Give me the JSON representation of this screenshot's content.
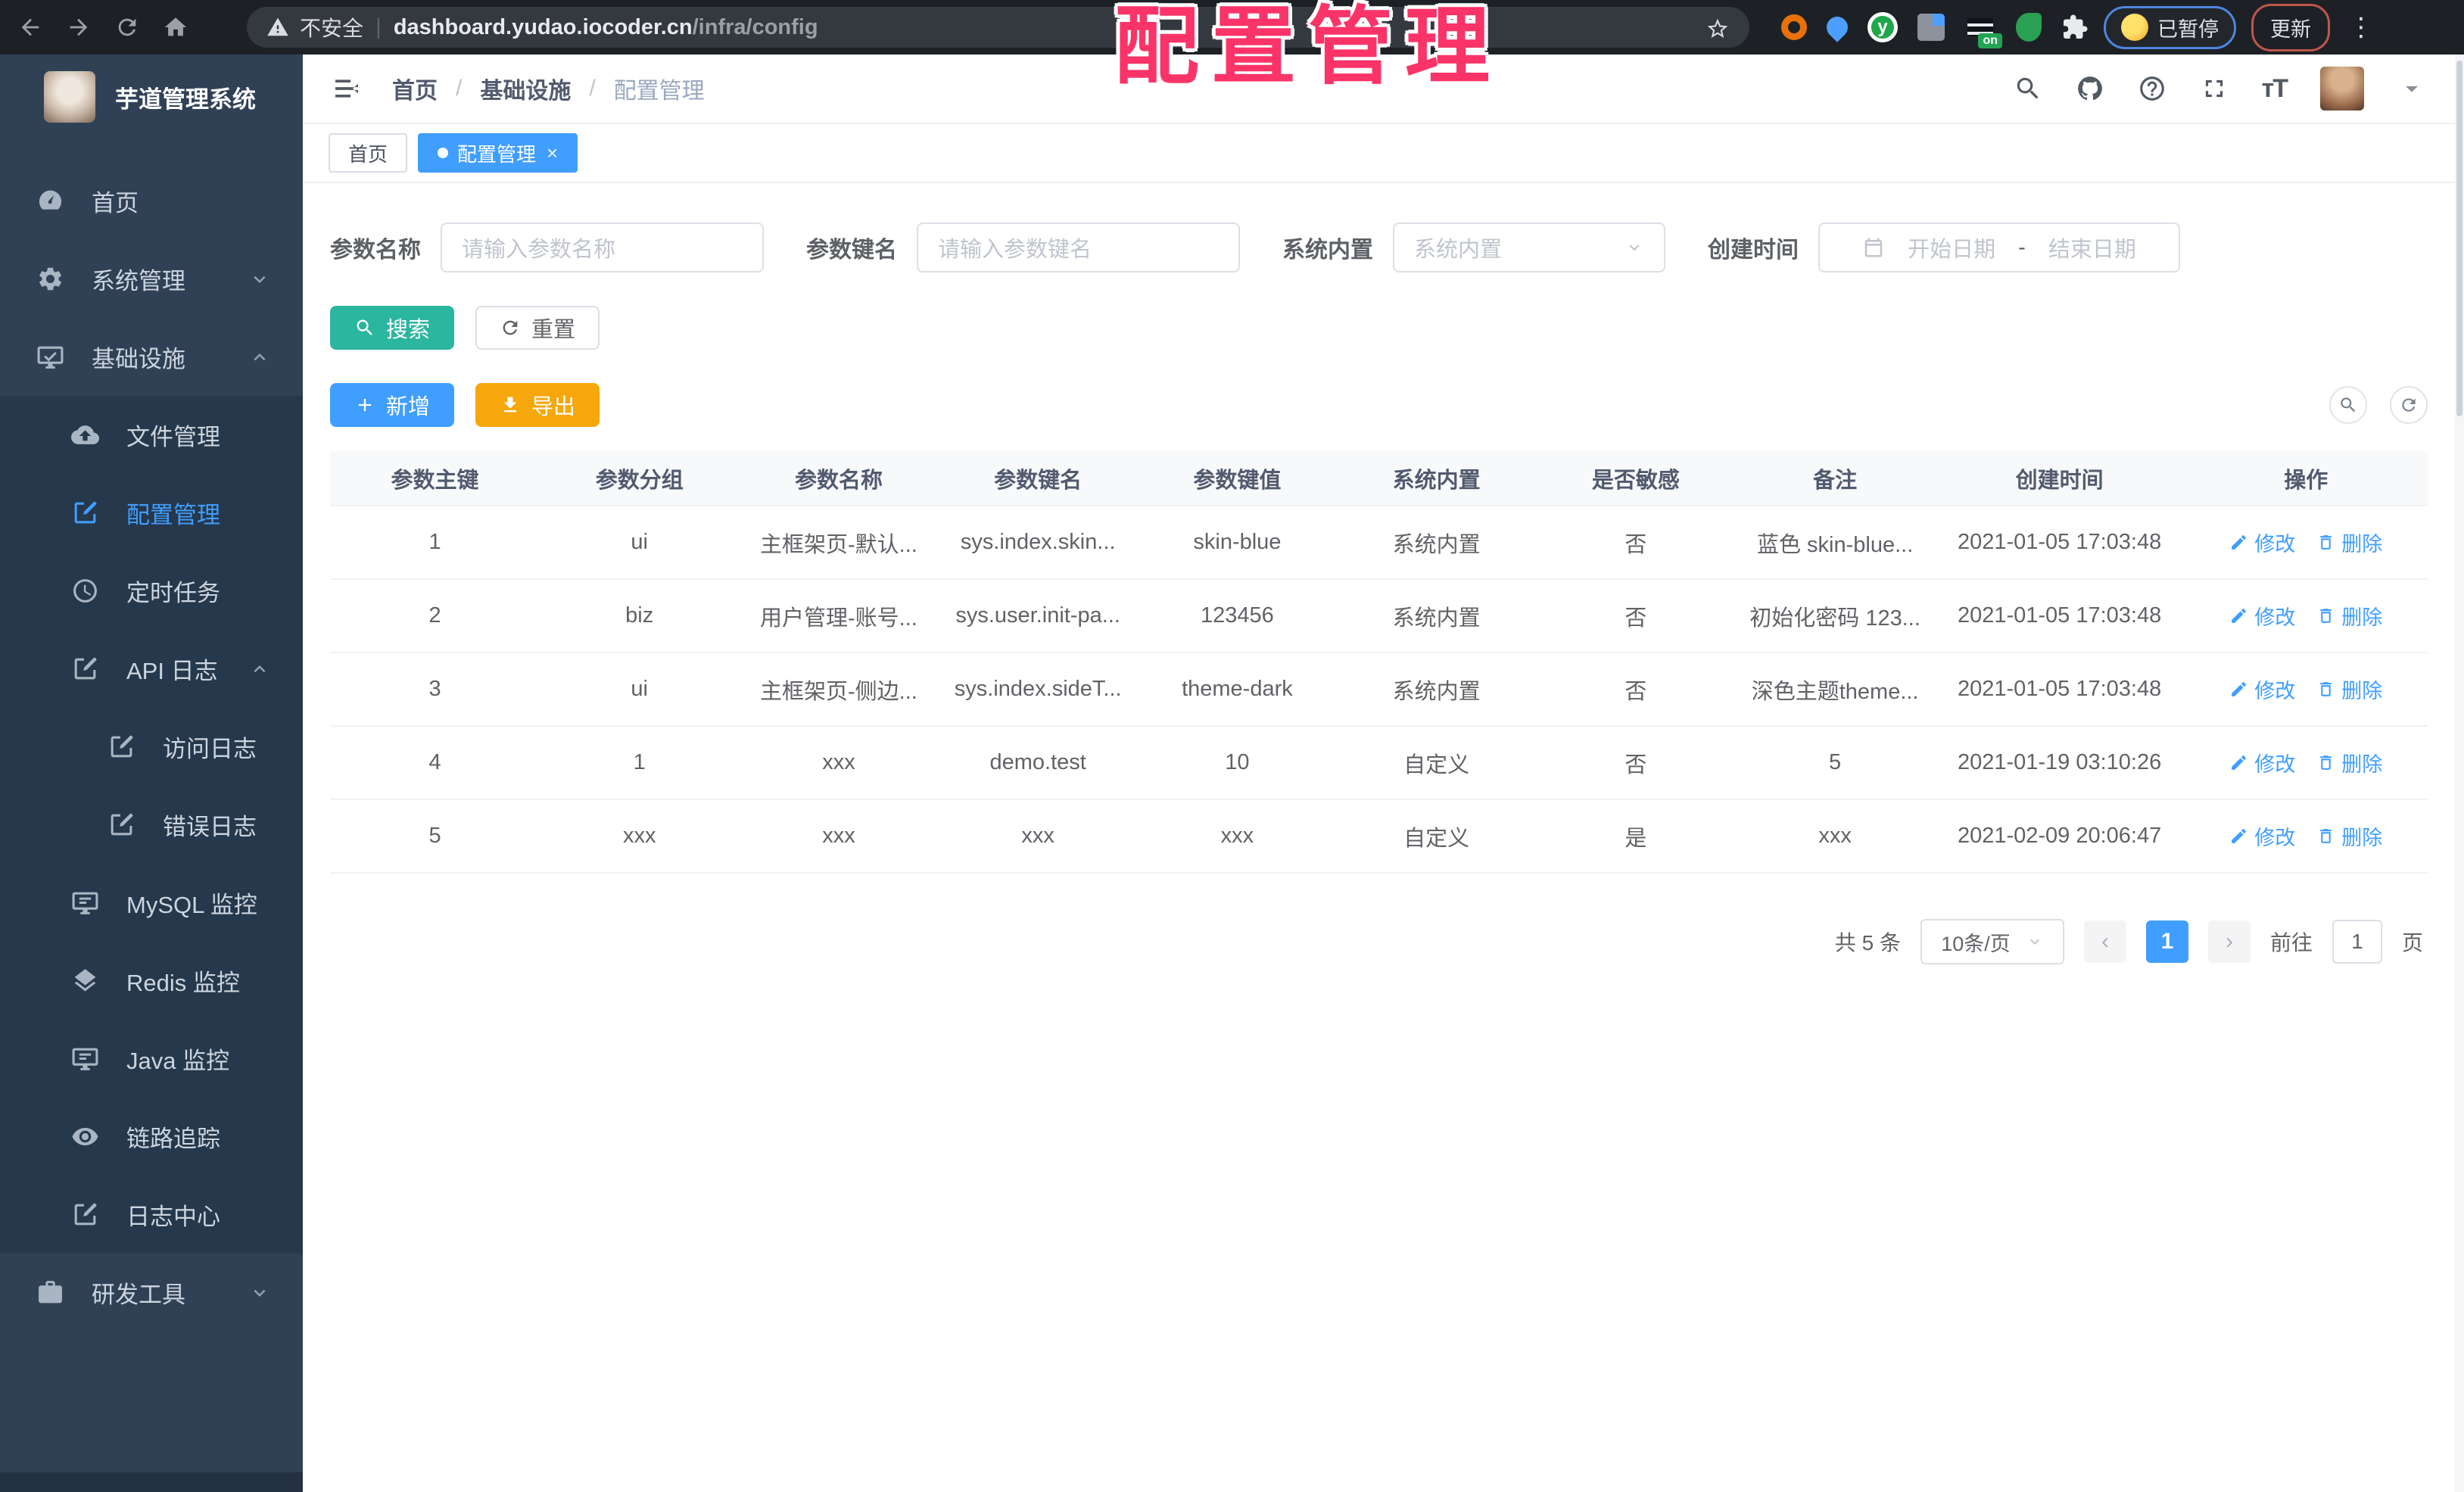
{
  "chrome": {
    "security_label": "不安全",
    "url_host": "dashboard.yudao.iocoder.cn",
    "url_path": "/infra/config",
    "paused_badge": "已暂停",
    "update_button": "更新"
  },
  "watermark": "配置管理",
  "sidebar": {
    "brand": "芋道管理系统",
    "items": [
      {
        "label": "首页",
        "icon": "dashboard-icon",
        "indent": 0,
        "zone": "top"
      },
      {
        "label": "系统管理",
        "icon": "gear-icon",
        "indent": 0,
        "zone": "top",
        "chevron": "down"
      },
      {
        "label": "基础设施",
        "icon": "monitor-check-icon",
        "indent": 0,
        "zone": "top",
        "chevron": "up"
      },
      {
        "label": "文件管理",
        "icon": "cloud-upload-icon",
        "indent": 1,
        "zone": "sub"
      },
      {
        "label": "配置管理",
        "icon": "edit-square-icon",
        "indent": 1,
        "zone": "sub",
        "active": true
      },
      {
        "label": "定时任务",
        "icon": "timer-icon",
        "indent": 1,
        "zone": "sub"
      },
      {
        "label": "API 日志",
        "icon": "edit-square-icon",
        "indent": 1,
        "zone": "sub",
        "chevron": "up"
      },
      {
        "label": "访问日志",
        "icon": "edit-square-icon",
        "indent": 2,
        "zone": "sub"
      },
      {
        "label": "错误日志",
        "icon": "edit-square-icon",
        "indent": 2,
        "zone": "sub"
      },
      {
        "label": "MySQL 监控",
        "icon": "monitor-icon",
        "indent": 1,
        "zone": "sub"
      },
      {
        "label": "Redis 监控",
        "icon": "layers-icon",
        "indent": 1,
        "zone": "sub"
      },
      {
        "label": "Java 监控",
        "icon": "monitor-icon",
        "indent": 1,
        "zone": "sub"
      },
      {
        "label": "链路追踪",
        "icon": "eye-icon",
        "indent": 1,
        "zone": "sub"
      },
      {
        "label": "日志中心",
        "icon": "edit-square-icon",
        "indent": 1,
        "zone": "sub"
      },
      {
        "label": "研发工具",
        "icon": "briefcase-icon",
        "indent": 0,
        "zone": "bottom",
        "chevron": "down"
      }
    ]
  },
  "header": {
    "breadcrumb": [
      "首页",
      "基础设施",
      "配置管理"
    ]
  },
  "tabs": [
    {
      "label": "首页",
      "active": false
    },
    {
      "label": "配置管理",
      "active": true
    }
  ],
  "filters": {
    "name": {
      "label": "参数名称",
      "placeholder": "请输入参数名称"
    },
    "key": {
      "label": "参数键名",
      "placeholder": "请输入参数键名"
    },
    "type": {
      "label": "系统内置",
      "placeholder": "系统内置"
    },
    "create_time": {
      "label": "创建时间",
      "start_placeholder": "开始日期",
      "separator": "-",
      "end_placeholder": "结束日期"
    },
    "search_label": "搜索",
    "reset_label": "重置"
  },
  "toolbar": {
    "add_label": "新增",
    "export_label": "导出"
  },
  "table": {
    "headers": [
      "参数主键",
      "参数分组",
      "参数名称",
      "参数键名",
      "参数键值",
      "系统内置",
      "是否敏感",
      "备注",
      "创建时间",
      "操作"
    ],
    "edit_label": "修改",
    "delete_label": "删除",
    "rows": [
      [
        "1",
        "ui",
        "主框架页-默认...",
        "sys.index.skin...",
        "skin-blue",
        "系统内置",
        "否",
        "蓝色 skin-blue...",
        "2021-01-05 17:03:48"
      ],
      [
        "2",
        "biz",
        "用户管理-账号...",
        "sys.user.init-pa...",
        "123456",
        "系统内置",
        "否",
        "初始化密码 123...",
        "2021-01-05 17:03:48"
      ],
      [
        "3",
        "ui",
        "主框架页-侧边...",
        "sys.index.sideT...",
        "theme-dark",
        "系统内置",
        "否",
        "深色主题theme...",
        "2021-01-05 17:03:48"
      ],
      [
        "4",
        "1",
        "xxx",
        "demo.test",
        "10",
        "自定义",
        "否",
        "5",
        "2021-01-19 03:10:26"
      ],
      [
        "5",
        "xxx",
        "xxx",
        "xxx",
        "xxx",
        "自定义",
        "是",
        "xxx",
        "2021-02-09 20:06:47"
      ]
    ]
  },
  "pagination": {
    "total": "共 5 条",
    "page_size": "10条/页",
    "current": "1",
    "goto_label": "前往",
    "goto_value": "1",
    "page_suffix": "页"
  },
  "colors": {
    "accent": "#409eff",
    "search_button": "#2bb69f",
    "export_button": "#f5a70b",
    "annotation_pink": "#fa3468",
    "sidebar": "#304156"
  }
}
